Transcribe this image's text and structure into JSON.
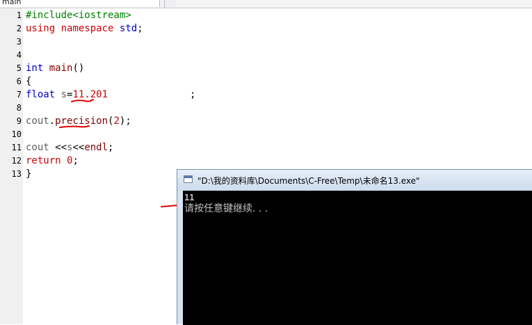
{
  "tab": {
    "label": "main"
  },
  "code_lines": [
    {
      "n": "1",
      "segs": [
        [
          "pp",
          "#include<iostream>"
        ]
      ]
    },
    {
      "n": "2",
      "segs": [
        [
          "kw",
          "using"
        ],
        [
          "plain",
          " "
        ],
        [
          "kw",
          "namespace"
        ],
        [
          "plain",
          " "
        ],
        [
          "tp",
          "std"
        ],
        [
          "plain",
          ";"
        ]
      ]
    },
    {
      "n": "3",
      "segs": []
    },
    {
      "n": "4",
      "segs": []
    },
    {
      "n": "5",
      "segs": [
        [
          "tp",
          "int"
        ],
        [
          "plain",
          " "
        ],
        [
          "fn",
          "main"
        ],
        [
          "plain",
          "()"
        ]
      ]
    },
    {
      "n": "6",
      "segs": [
        [
          "plain",
          "{"
        ]
      ]
    },
    {
      "n": "7",
      "segs": [
        [
          "tp",
          "float"
        ],
        [
          "plain",
          " "
        ],
        [
          "ident",
          "s"
        ],
        [
          "plain",
          "="
        ],
        [
          "num",
          "11.201"
        ],
        [
          "plain",
          "              ;"
        ]
      ]
    },
    {
      "n": "8",
      "segs": []
    },
    {
      "n": "9",
      "segs": [
        [
          "ident",
          "cout"
        ],
        [
          "plain",
          "."
        ],
        [
          "fn",
          "precision"
        ],
        [
          "plain",
          "("
        ],
        [
          "num",
          "2"
        ],
        [
          "plain",
          ");"
        ]
      ]
    },
    {
      "n": "10",
      "segs": []
    },
    {
      "n": "11",
      "segs": [
        [
          "ident",
          "cout"
        ],
        [
          "plain",
          " <<"
        ],
        [
          "ident",
          "s"
        ],
        [
          "plain",
          "<<"
        ],
        [
          "fn",
          "endl"
        ],
        [
          "plain",
          ";"
        ]
      ]
    },
    {
      "n": "12",
      "segs": [
        [
          "kw",
          "return"
        ],
        [
          "plain",
          " "
        ],
        [
          "num",
          "0"
        ],
        [
          "plain",
          ";"
        ]
      ]
    },
    {
      "n": "13",
      "segs": [
        [
          "plain",
          "}"
        ]
      ]
    }
  ],
  "console": {
    "title": "\"D:\\我的资料库\\Documents\\C-Free\\Temp\\未命名13.exe\"",
    "output_value": "11",
    "prompt": "请按任意键继续. . ."
  },
  "colors": {
    "keyword": "#c80000",
    "type": "#0000cc",
    "preprocessor": "#008000",
    "annotation_ink": "#e00000",
    "console_bg": "#000000",
    "console_text": "#c0c0c0"
  }
}
